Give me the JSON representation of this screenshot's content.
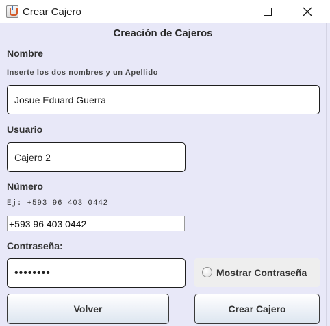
{
  "window": {
    "title": "Crear Cajero",
    "controls": {
      "minimize": "minimize-icon",
      "maximize": "maximize-icon",
      "close": "close-icon"
    }
  },
  "form": {
    "heading": "Creación de Cajeros",
    "nombre": {
      "label": "Nombre",
      "hint": "Inserte los dos nombres y un Apellido",
      "value": "Josue Eduard Guerra"
    },
    "usuario": {
      "label": "Usuario",
      "value": "Cajero 2"
    },
    "numero": {
      "label": "Número",
      "hint": "Ej: +593 96 403 0442",
      "value": "+593 96 403 0442"
    },
    "contrasena": {
      "label": "Contraseña:",
      "value": "••••••••",
      "show_toggle_label": "Mostrar Contraseña",
      "show_toggle_checked": false
    }
  },
  "buttons": {
    "back": "Volver",
    "create": "Crear Cajero"
  },
  "colors": {
    "content_background": "#e8e8f8",
    "titlebar_background": "#ffffff"
  }
}
